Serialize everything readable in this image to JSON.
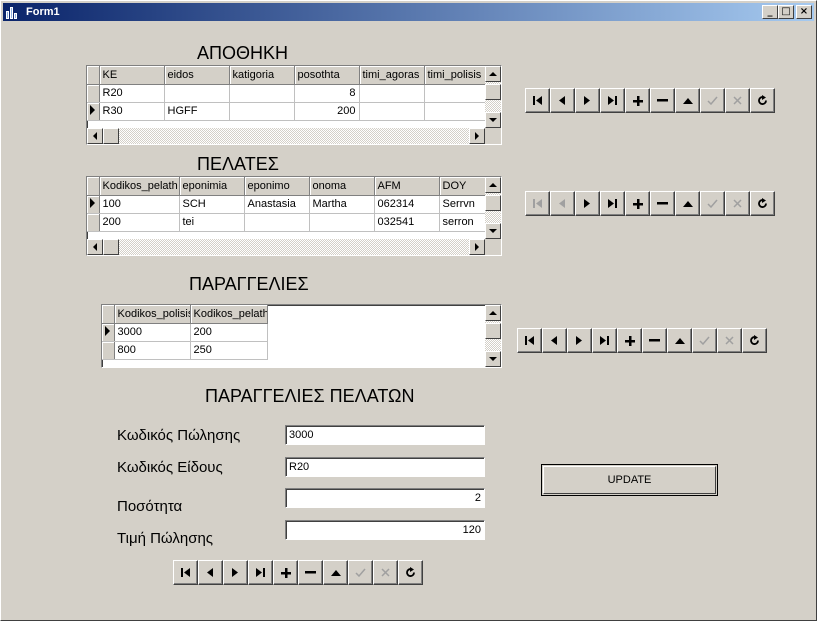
{
  "window": {
    "title": "Form1"
  },
  "colors": {
    "accent": "#0a246a",
    "face": "#d4d0c8"
  },
  "headings": {
    "apothiki": "ΑΠΟΘΗΚΗ",
    "pelates": "ΠΕΛΑΤΕΣ",
    "paraggelies": "ΠΑΡΑΓΓΕΛΙΕΣ",
    "paraggelies_pelaton": "ΠΑΡΑΓΓΕΛΙΕΣ ΠΕΛΑΤΩΝ"
  },
  "grid_apothiki": {
    "columns": [
      "KE",
      "eidos",
      "katigoria",
      "posothta",
      "timi_agoras",
      "timi_polisis"
    ],
    "rows": [
      [
        "R20",
        "",
        "",
        "8",
        "",
        ""
      ],
      [
        "R30",
        "HGFF",
        "",
        "200",
        "",
        ""
      ]
    ],
    "current_row": 1
  },
  "grid_pelates": {
    "columns": [
      "Kodikos_pelath",
      "eponimia",
      "eponimo",
      "onoma",
      "AFM",
      "DOY"
    ],
    "rows": [
      [
        "100",
        "SCH",
        "Anastasia",
        "Martha",
        "062314",
        "Serrvn"
      ],
      [
        "200",
        "tei",
        "",
        "",
        "032541",
        "serron"
      ]
    ],
    "current_row": 0
  },
  "grid_paraggelies": {
    "columns": [
      "Kodikos_polisis",
      "Kodikos_pelath"
    ],
    "rows": [
      [
        "3000",
        "200"
      ],
      [
        "800",
        "250"
      ]
    ],
    "current_row": 0
  },
  "form": {
    "fields": [
      {
        "label": "Κωδικός Πώλησης",
        "value": "3000"
      },
      {
        "label": "Κωδικός Είδους",
        "value": "R20"
      },
      {
        "label": "Ποσότητα",
        "value": "2"
      },
      {
        "label": "Τιμή Πώλησης",
        "value": "120"
      }
    ],
    "update_label": "UPDATE"
  },
  "navigator": {
    "buttons": [
      "first-icon",
      "prior-icon",
      "next-icon",
      "last-icon",
      "insert-icon",
      "delete-icon",
      "edit-icon",
      "post-icon",
      "cancel-icon",
      "refresh-icon"
    ]
  }
}
